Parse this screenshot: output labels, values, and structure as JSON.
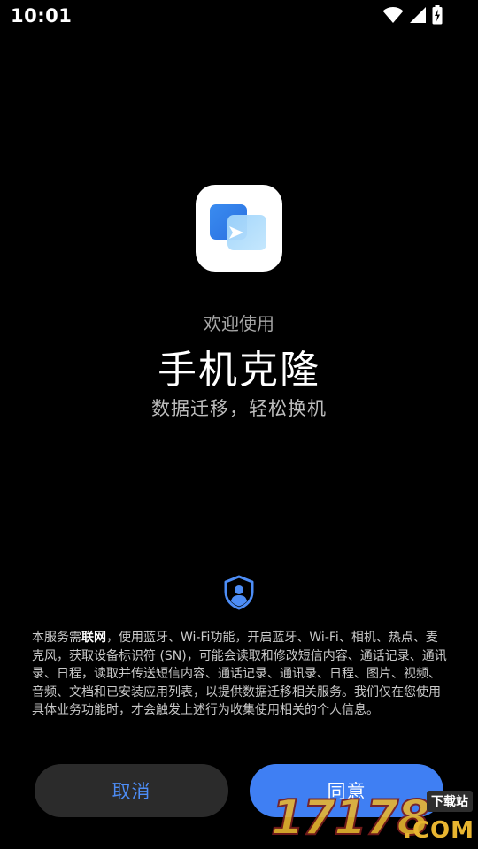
{
  "status_bar": {
    "time": "10:01",
    "icons": [
      "wifi-icon",
      "cell-signal-icon",
      "battery-charging-icon"
    ]
  },
  "app": {
    "icon": "phone-clone-icon",
    "welcome": "欢迎使用",
    "title": "手机克隆",
    "tagline": "数据迁移，轻松换机"
  },
  "privacy": {
    "icon": "privacy-shield-icon",
    "intro": "本服务需",
    "bold": "联网",
    "body": "，使用蓝牙、Wi-Fi功能，开启蓝牙、Wi-Fi、相机、热点、麦克风，获取设备标识符 (SN)，可能会读取和修改短信内容、通话记录、通讯录、日程，读取并传送短信内容、通话记录、通讯录、日程、图片、视频、音频、文档和已安装应用列表，以提供数据迁移相关服务。我们仅在您使用具体业务功能时，才会触发上述行为收集使用相关的个人信息。"
  },
  "buttons": {
    "cancel": "取消",
    "agree": "同意"
  },
  "watermark": {
    "main": "17178",
    "tag": "下载站",
    "com": ".COM"
  },
  "colors": {
    "background": "#000000",
    "accent": "#3f7ff3",
    "cancel_bg": "#2b2b2b",
    "cancel_text": "#4d8df6"
  }
}
